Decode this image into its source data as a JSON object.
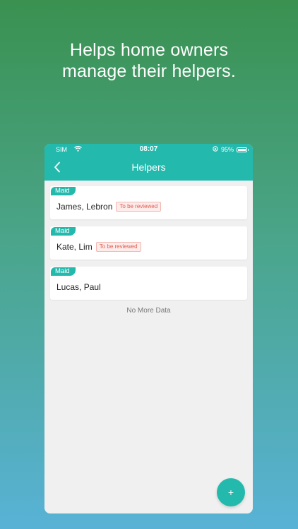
{
  "headline": {
    "line1": "Helps home owners",
    "line2": "manage their helpers."
  },
  "status_bar": {
    "carrier": "SIM",
    "time": "08:07",
    "battery": "95%"
  },
  "navbar": {
    "title": "Helpers"
  },
  "helpers": [
    {
      "role": "Maid",
      "name": "James, Lebron",
      "status": "To be reviewed"
    },
    {
      "role": "Maid",
      "name": "Kate, Lim",
      "status": "To be reviewed"
    },
    {
      "role": "Maid",
      "name": "Lucas, Paul",
      "status": ""
    }
  ],
  "list_footer": "No More Data",
  "fab_label": "+",
  "colors": {
    "accent": "#23b9ad",
    "badge_text": "#e05a50"
  }
}
